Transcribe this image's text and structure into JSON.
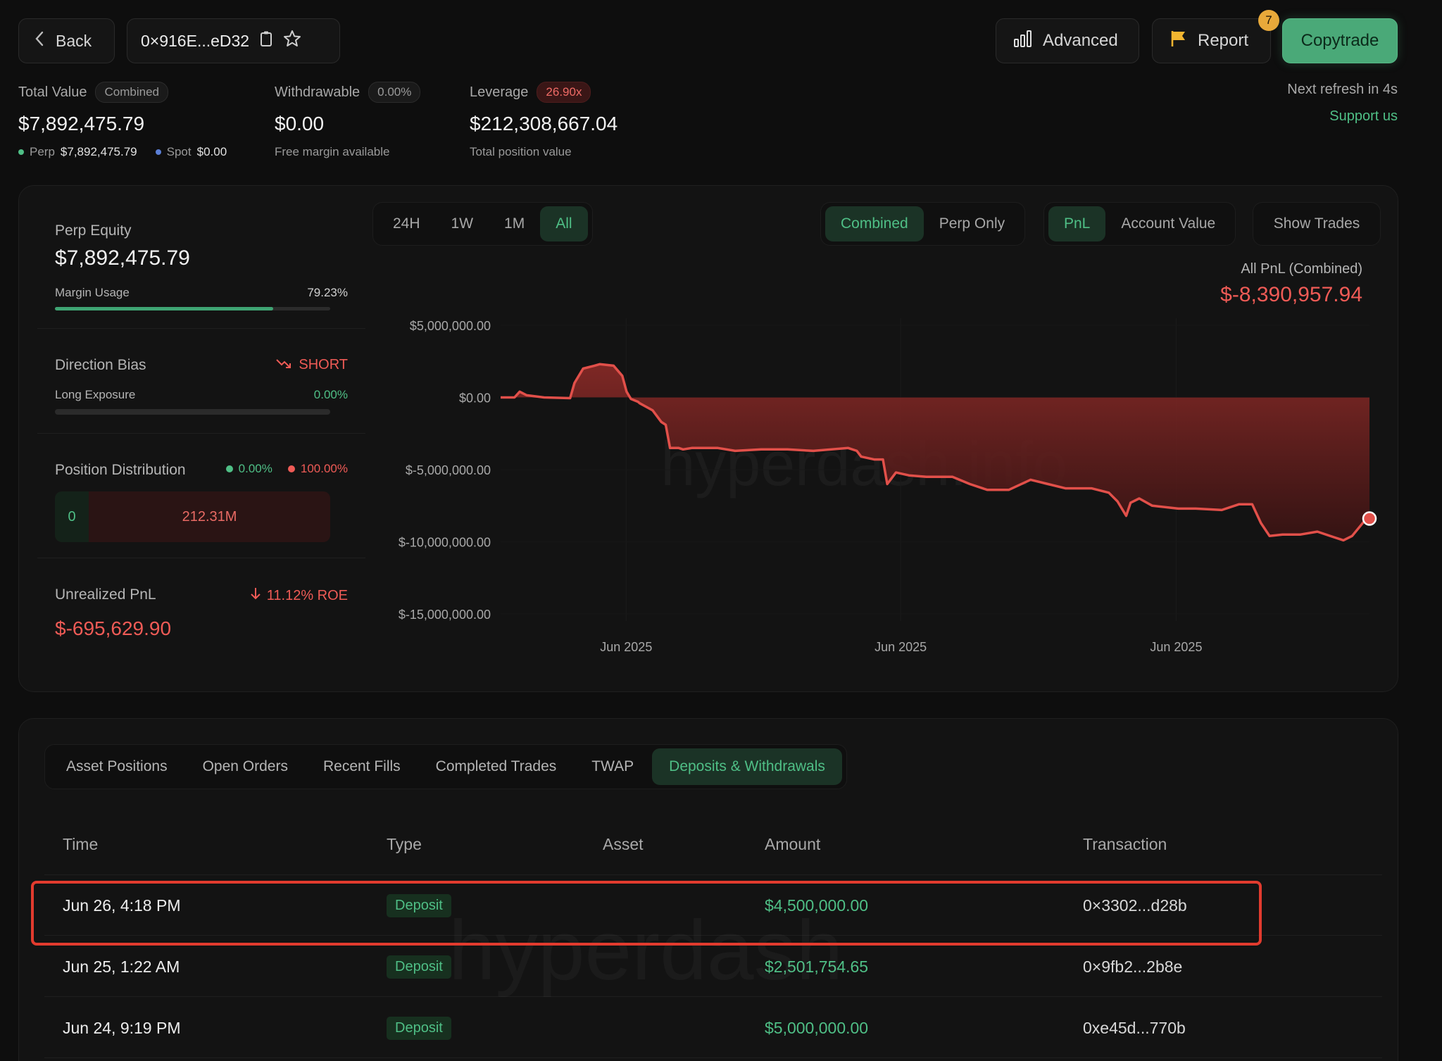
{
  "header": {
    "back_label": "Back",
    "address": "0×916E...eD32",
    "advanced_label": "Advanced",
    "report_label": "Report",
    "report_badge": "7",
    "copytrade_label": "Copytrade"
  },
  "stats": {
    "total_value": {
      "label": "Total Value",
      "pill": "Combined",
      "value": "$7,892,475.79",
      "perp_label": "Perp",
      "perp_value": "$7,892,475.79",
      "spot_label": "Spot",
      "spot_value": "$0.00"
    },
    "withdrawable": {
      "label": "Withdrawable",
      "pill": "0.00%",
      "value": "$0.00",
      "sub": "Free margin available"
    },
    "leverage": {
      "label": "Leverage",
      "pill": "26.90x",
      "value": "$212,308,667.04",
      "sub": "Total position value"
    },
    "refresh": "Next refresh in 4s",
    "support": "Support us"
  },
  "left_panel": {
    "perp_equity": {
      "label": "Perp Equity",
      "value": "$7,892,475.79",
      "margin_label": "Margin Usage",
      "margin_value": "79.23%",
      "margin_fraction": 0.7923
    },
    "direction": {
      "label": "Direction Bias",
      "bias": "SHORT",
      "long_label": "Long Exposure",
      "long_value": "0.00%",
      "long_fraction": 0
    },
    "distribution": {
      "label": "Position Distribution",
      "long_pct": "0.00%",
      "short_pct": "100.00%",
      "long_amount": "0",
      "short_amount": "212.31M"
    },
    "unrealized": {
      "label": "Unrealized PnL",
      "roe": "11.12% ROE",
      "value": "$-695,629.90"
    }
  },
  "chart_controls": {
    "ranges": [
      "24H",
      "1W",
      "1M",
      "All"
    ],
    "active_range": "All",
    "modes": [
      "Combined",
      "Perp Only"
    ],
    "active_mode": "Combined",
    "metrics": [
      "PnL",
      "Account Value"
    ],
    "active_metric": "PnL",
    "show_trades": "Show Trades"
  },
  "chart_data": {
    "type": "area",
    "title": "All PnL (Combined)",
    "headline_value": "$-8,390,957.94",
    "ylim": [
      -15000000,
      5000000
    ],
    "y_ticks": [
      "$5,000,000.00",
      "$0.00",
      "$-5,000,000.00",
      "$-10,000,000.00",
      "$-15,000,000.00"
    ],
    "y_tick_values": [
      5000000,
      0,
      -5000000,
      -10000000,
      -15000000
    ],
    "x_ticks": [
      "Jun 2025",
      "Jun 2025",
      "Jun 2025"
    ],
    "x_tick_positions": [
      0.1445,
      0.4604,
      0.7775
    ],
    "watermark": "hyperdash.info",
    "line_color": "#e2504a",
    "series": [
      {
        "x": [
          0,
          0.016,
          0.022,
          0.03,
          0.05,
          0.08,
          0.085,
          0.095,
          0.108,
          0.114,
          0.13,
          0.14,
          0.145,
          0.15,
          0.158,
          0.16,
          0.175,
          0.185,
          0.19,
          0.195,
          0.205,
          0.21,
          0.22,
          0.25,
          0.27,
          0.3,
          0.33,
          0.36,
          0.4,
          0.41,
          0.415,
          0.43,
          0.44,
          0.445,
          0.455,
          0.47,
          0.49,
          0.52,
          0.54,
          0.56,
          0.585,
          0.61,
          0.63,
          0.65,
          0.68,
          0.7,
          0.71,
          0.72,
          0.725,
          0.735,
          0.75,
          0.78,
          0.8,
          0.83,
          0.85,
          0.86,
          0.865,
          0.875,
          0.885,
          0.9,
          0.92,
          0.94,
          0.96,
          0.97,
          0.98,
          0.995,
          1.0
        ],
        "y": [
          0,
          0,
          400000,
          150000,
          0,
          -50000,
          1000000,
          2000000,
          2200000,
          2300000,
          2200000,
          1500000,
          400000,
          -100000,
          -300000,
          -400000,
          -900000,
          -1700000,
          -1900000,
          -3500000,
          -3500000,
          -3600000,
          -3500000,
          -3500000,
          -3700000,
          -3600000,
          -3600000,
          -3700000,
          -3500000,
          -3700000,
          -4100000,
          -4300000,
          -4300000,
          -6000000,
          -5200000,
          -5400000,
          -5500000,
          -5500000,
          -6000000,
          -6400000,
          -6400000,
          -5700000,
          -6000000,
          -6300000,
          -6300000,
          -6600000,
          -7200000,
          -8200000,
          -7300000,
          -7000000,
          -7500000,
          -7700000,
          -7700000,
          -7800000,
          -7400000,
          -7400000,
          -7400000,
          -8700000,
          -9600000,
          -9500000,
          -9500000,
          -9300000,
          -9700000,
          -9900000,
          -9600000,
          -8500000,
          -8390957
        ]
      }
    ]
  },
  "table": {
    "tabs": [
      "Asset Positions",
      "Open Orders",
      "Recent Fills",
      "Completed Trades",
      "TWAP",
      "Deposits & Withdrawals"
    ],
    "active_tab": "Deposits & Withdrawals",
    "columns": [
      "Time",
      "Type",
      "Asset",
      "Amount",
      "Transaction"
    ],
    "rows": [
      {
        "time": "Jun 26, 4:18 PM",
        "type": "Deposit",
        "asset": "",
        "amount": "$4,500,000.00",
        "tx": "0×3302...d28b"
      },
      {
        "time": "Jun 25, 1:22 AM",
        "type": "Deposit",
        "asset": "",
        "amount": "$2,501,754.65",
        "tx": "0×9fb2...2b8e"
      },
      {
        "time": "Jun 24, 9:19 PM",
        "type": "Deposit",
        "asset": "",
        "amount": "$5,000,000.00",
        "tx": "0xe45d...770b"
      }
    ],
    "watermark": "hyperdash"
  },
  "colors": {
    "accent_green": "#4fbf86",
    "accent_red": "#ef5b56",
    "highlight_border": "#e23b2e",
    "notif_badge": "#e8a93a"
  }
}
